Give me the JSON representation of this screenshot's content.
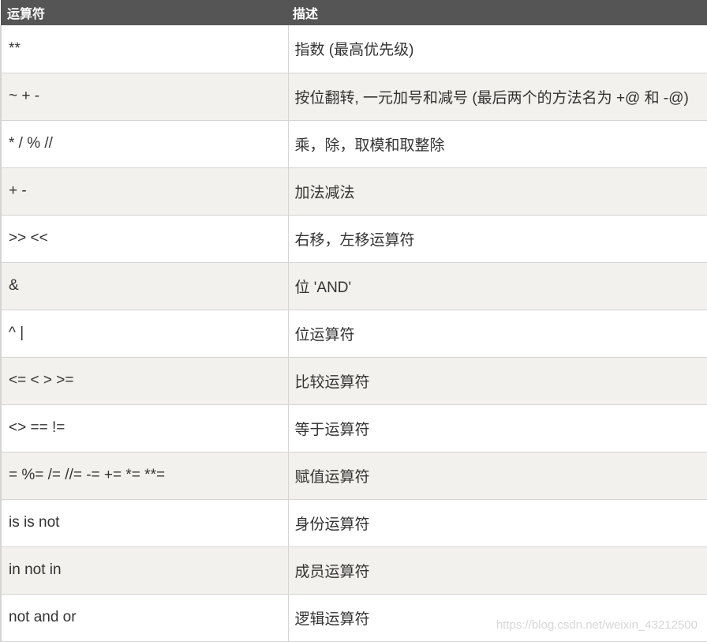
{
  "header": {
    "col_operator": "运算符",
    "col_description": "描述"
  },
  "rows": [
    {
      "operator": "**",
      "description": "指数 (最高优先级)"
    },
    {
      "operator": "~ + -",
      "description": "按位翻转, 一元加号和减号 (最后两个的方法名为 +@ 和 -@)"
    },
    {
      "operator": "* / % //",
      "description": "乘，除，取模和取整除"
    },
    {
      "operator": "+ -",
      "description": "加法减法"
    },
    {
      "operator": ">> <<",
      "description": "右移，左移运算符"
    },
    {
      "operator": "&",
      "description": "位 'AND'"
    },
    {
      "operator": "^ |",
      "description": "位运算符"
    },
    {
      "operator": "<= < > >=",
      "description": "比较运算符"
    },
    {
      "operator": "<> == !=",
      "description": "等于运算符"
    },
    {
      "operator": "= %= /= //= -= += *= **=",
      "description": "赋值运算符"
    },
    {
      "operator": "is is not",
      "description": "身份运算符"
    },
    {
      "operator": "in not in",
      "description": "成员运算符"
    },
    {
      "operator": "not and or",
      "description": "逻辑运算符"
    }
  ],
  "watermark": "https://blog.csdn.net/weixin_43212500",
  "colors": {
    "header_bg": "#555555",
    "header_text": "#ffffff",
    "row_alt_bg": "#f2f1ed",
    "text": "#333333"
  }
}
